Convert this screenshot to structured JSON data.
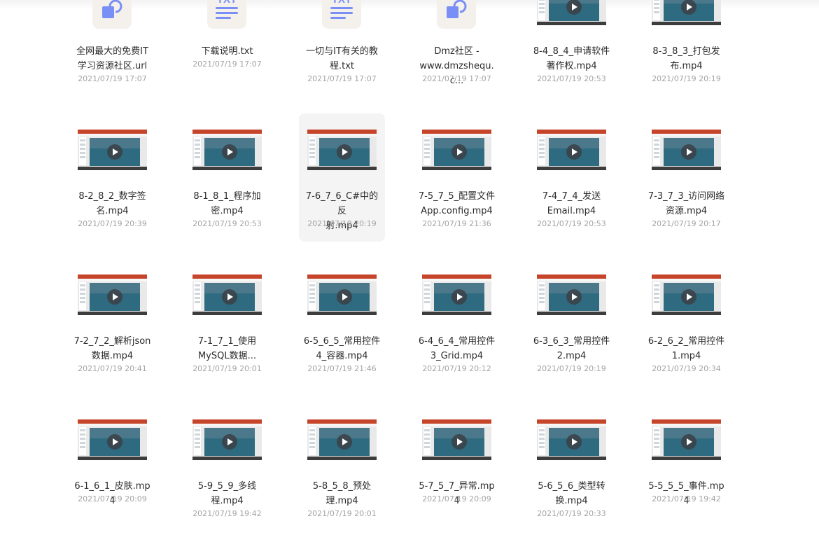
{
  "files": [
    {
      "name_lines": [
        "全网最大的免费IT",
        "学习资源社区.url"
      ],
      "date": "2021/07/19 17:07",
      "type": "url",
      "icon": "link-file-icon"
    },
    {
      "name_lines": [
        "下载说明.txt"
      ],
      "date": "2021/07/19 17:07",
      "type": "txt",
      "icon": "txt-file-icon",
      "ext": "TXT"
    },
    {
      "name_lines": [
        "一切与IT有关的教",
        "程.txt"
      ],
      "date": "2021/07/19 17:07",
      "type": "txt",
      "icon": "txt-file-icon",
      "ext": "TXT"
    },
    {
      "name_lines": [
        "Dmz社区 -",
        "www.dmzshequ.c..."
      ],
      "date": "2021/07/19 17:07",
      "type": "url",
      "icon": "link-file-icon"
    },
    {
      "name_lines": [
        "8-4_8_4_申请软件",
        "著作权.mp4"
      ],
      "date": "2021/07/19 20:53",
      "type": "video",
      "icon": "video-thumbnail"
    },
    {
      "name_lines": [
        "8-3_8_3_打包发",
        "布.mp4"
      ],
      "date": "2021/07/19 20:19",
      "type": "video",
      "icon": "video-thumbnail"
    },
    {
      "name_lines": [
        "8-2_8_2_数字签",
        "名.mp4"
      ],
      "date": "2021/07/19 20:39",
      "type": "video",
      "icon": "video-thumbnail"
    },
    {
      "name_lines": [
        "8-1_8_1_程序加",
        "密.mp4"
      ],
      "date": "2021/07/19 20:53",
      "type": "video",
      "icon": "video-thumbnail"
    },
    {
      "name_lines": [
        "7-6_7_6_C#中的反",
        "射.mp4"
      ],
      "date": "2021/07/19 20:19",
      "type": "video",
      "icon": "video-thumbnail",
      "selected": true
    },
    {
      "name_lines": [
        "7-5_7_5_配置文件",
        "App.config.mp4"
      ],
      "date": "2021/07/19 21:36",
      "type": "video",
      "icon": "video-thumbnail"
    },
    {
      "name_lines": [
        "7-4_7_4_发送",
        "Email.mp4"
      ],
      "date": "2021/07/19 20:53",
      "type": "video",
      "icon": "video-thumbnail"
    },
    {
      "name_lines": [
        "7-3_7_3_访问网络",
        "资源.mp4"
      ],
      "date": "2021/07/19 20:17",
      "type": "video",
      "icon": "video-thumbnail"
    },
    {
      "name_lines": [
        "7-2_7_2_解析json",
        "数据.mp4"
      ],
      "date": "2021/07/19 20:41",
      "type": "video",
      "icon": "video-thumbnail"
    },
    {
      "name_lines": [
        "7-1_7_1_使用",
        "MySQL数据..."
      ],
      "date": "2021/07/19 20:01",
      "type": "video",
      "icon": "video-thumbnail"
    },
    {
      "name_lines": [
        "6-5_6_5_常用控件",
        "4_容器.mp4"
      ],
      "date": "2021/07/19 21:46",
      "type": "video",
      "icon": "video-thumbnail"
    },
    {
      "name_lines": [
        "6-4_6_4_常用控件",
        "3_Grid.mp4"
      ],
      "date": "2021/07/19 20:12",
      "type": "video",
      "icon": "video-thumbnail"
    },
    {
      "name_lines": [
        "6-3_6_3_常用控件",
        "2.mp4"
      ],
      "date": "2021/07/19 20:19",
      "type": "video",
      "icon": "video-thumbnail"
    },
    {
      "name_lines": [
        "6-2_6_2_常用控件",
        "1.mp4"
      ],
      "date": "2021/07/19 20:34",
      "type": "video",
      "icon": "video-thumbnail"
    },
    {
      "name_lines": [
        "6-1_6_1_皮肤.mp4"
      ],
      "date": "2021/07/19 20:09",
      "type": "video",
      "icon": "video-thumbnail"
    },
    {
      "name_lines": [
        "5-9_5_9_多线",
        "程.mp4"
      ],
      "date": "2021/07/19 19:42",
      "type": "video",
      "icon": "video-thumbnail"
    },
    {
      "name_lines": [
        "5-8_5_8_预处",
        "理.mp4"
      ],
      "date": "2021/07/19 20:01",
      "type": "video",
      "icon": "video-thumbnail"
    },
    {
      "name_lines": [
        "5-7_5_7_异常.mp4"
      ],
      "date": "2021/07/19 20:09",
      "type": "video",
      "icon": "video-thumbnail"
    },
    {
      "name_lines": [
        "5-6_5_6_类型转",
        "换.mp4"
      ],
      "date": "2021/07/19 20:33",
      "type": "video",
      "icon": "video-thumbnail"
    },
    {
      "name_lines": [
        "5-5_5_5_事件.mp4"
      ],
      "date": "2021/07/19 19:42",
      "type": "video",
      "icon": "video-thumbnail"
    }
  ],
  "colors": {
    "doc_icon_bg": "#f4f1ec",
    "doc_icon_glyph": "#7a8ff5",
    "video_header": "#c6452a",
    "video_slide": "#2e6a80",
    "name_text": "#2b2b2b",
    "date_text": "#a3a3a3",
    "selected_bg": "#f4f4f4"
  }
}
